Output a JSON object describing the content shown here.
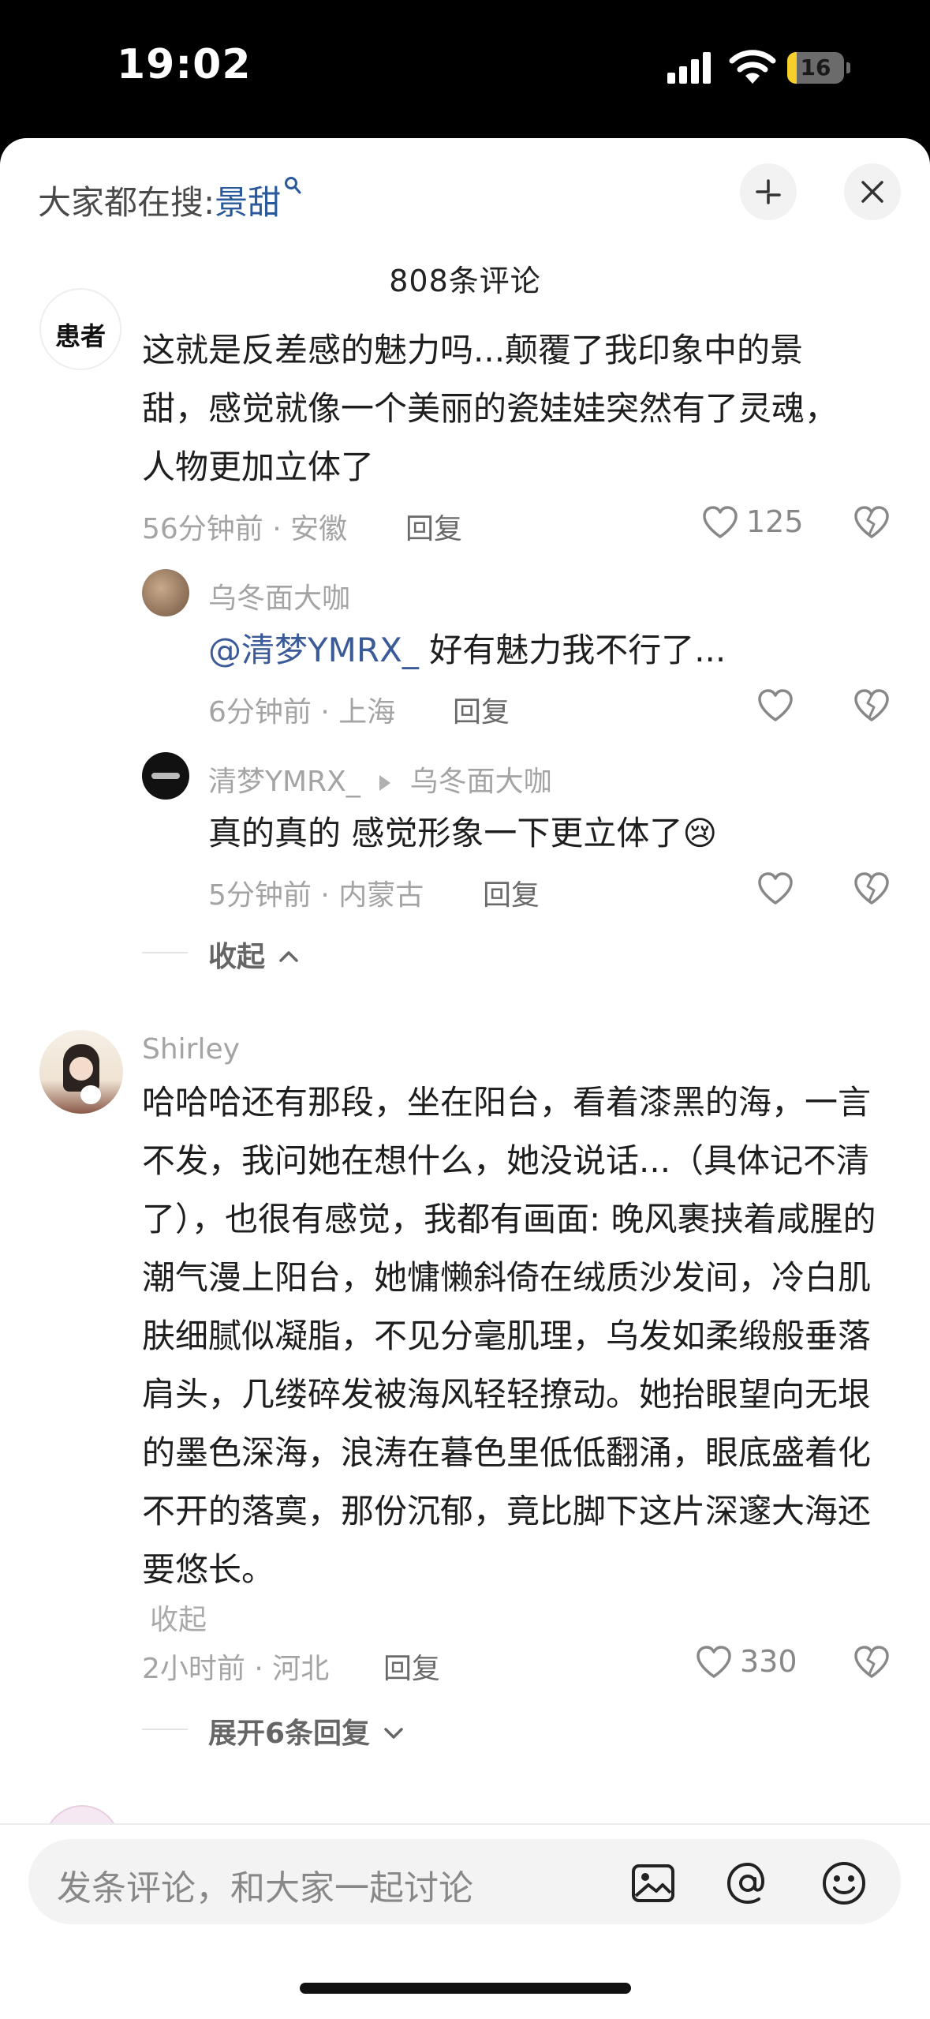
{
  "status_bar": {
    "time": "19:02",
    "battery": "16",
    "battery_level_percent": 16
  },
  "header": {
    "search_prefix": "大家都在搜:",
    "search_term": "景甜",
    "comment_count": "808条评论"
  },
  "comments": [
    {
      "avatar_text": "患者",
      "text": "这就是反差感的魅力吗...颠覆了我印象中的景甜，感觉就像一个美丽的瓷娃娃突然有了灵魂，人物更加立体了",
      "meta": "56分钟前 · 安徽",
      "reply_label": "回复",
      "likes": "125",
      "replies": [
        {
          "user": "乌冬面大咖",
          "mention": "@清梦YMRX_",
          "text": " 好有魅力我不行了...",
          "meta": "6分钟前 · 上海",
          "reply_label": "回复"
        },
        {
          "user": "清梦YMRX_",
          "reply_to": "乌冬面大咖",
          "text": "真的真的 感觉形象一下更立体了",
          "emoji": "😢",
          "meta": "5分钟前 · 内蒙古",
          "reply_label": "回复"
        }
      ],
      "collapse_label": "收起"
    },
    {
      "user": "Shirley",
      "text": "哈哈哈还有那段，坐在阳台，看着漆黑的海，一言不发，我问她在想什么，她没说话...（具体记不清了），也很有感觉，我都有画面: 晚风裹挟着咸腥的潮气漫上阳台，她慵懒斜倚在绒质沙发间，冷白肌肤细腻似凝脂，不见分毫肌理，乌发如柔缎般垂落肩头，几缕碎发被海风轻轻撩动。她抬眼望向无垠的墨色深海，浪涛在暮色里低低翻涌，眼底盛着化不开的落寞，那份沉郁，竟比脚下这片深邃大海还要悠长。",
      "text_collapse": "收起",
      "meta": "2小时前 · 河北",
      "reply_label": "回复",
      "likes": "330",
      "expand_label": "展开6条回复"
    }
  ],
  "input_bar": {
    "placeholder": "发条评论，和大家一起讨论"
  }
}
